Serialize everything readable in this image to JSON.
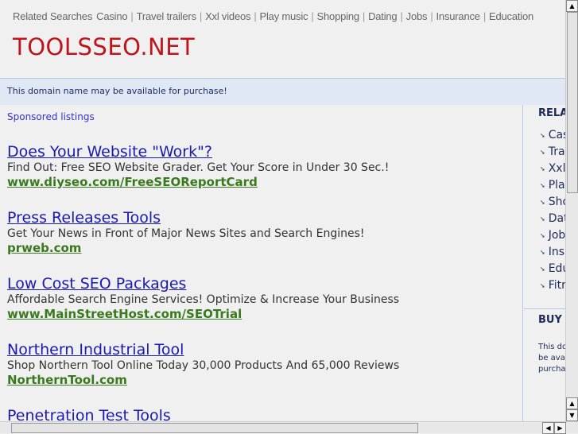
{
  "topnav": {
    "label": "Related Searches",
    "links": [
      "Casino",
      "Travel trailers",
      "Xxl videos",
      "Play music",
      "Shopping",
      "Dating",
      "Jobs",
      "Insurance",
      "Education"
    ]
  },
  "logo": "TOOLSSEO.NET",
  "notice": "This domain name may be available for purchase!",
  "sponsored": "Sponsored listings",
  "listings": [
    {
      "title": "Does Your Website \"Work\"?",
      "desc": "Find Out: Free SEO Website Grader. Get Your Score in Under 30 Sec.!",
      "url": "www.diyseo.com/FreeSEOReportCard"
    },
    {
      "title": "Press Releases Tools",
      "desc": "Get Your News in Front of Major News Sites and Search Engines!",
      "url": "prweb.com"
    },
    {
      "title": "Low Cost SEO Packages",
      "desc": "Affordable Search Engine Services! Optimize & Increase Your Business",
      "url": "www.MainStreetHost.com/SEOTrial"
    },
    {
      "title": "Northern Industrial Tool",
      "desc": "Shop Northern Tool Online Today 30,000 Products And 65,000 Reviews",
      "url": "NorthernTool.com"
    },
    {
      "title": "Penetration Test Tools",
      "desc": "",
      "url": ""
    }
  ],
  "sidebar": {
    "heading": "RELATED SEARCHES",
    "items": [
      "Casino",
      "Travel trailers",
      "Xxl videos",
      "Play music",
      "Shopping",
      "Dating",
      "Jobs",
      "Insurance",
      "Education",
      "Fitness"
    ],
    "buy_heading": "BUY THIS DOMAIN",
    "buy_text": "This domain name may be available for purchase"
  }
}
